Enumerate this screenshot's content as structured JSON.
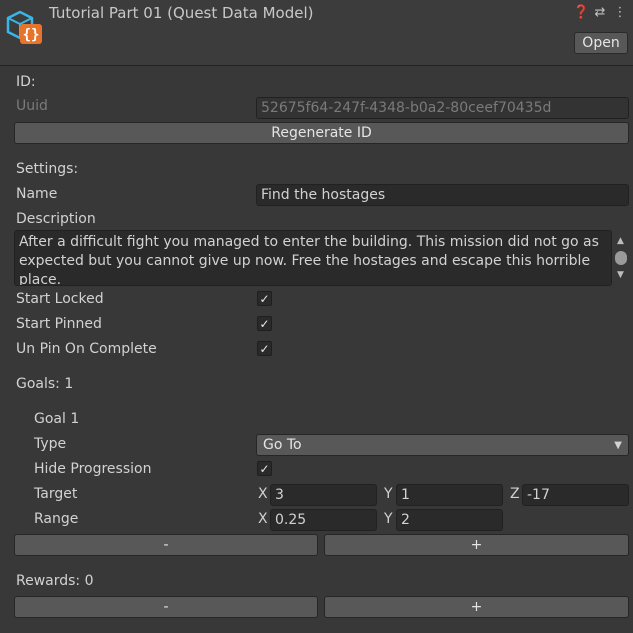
{
  "header": {
    "title": "Tutorial Part 01 (Quest Data Model)",
    "icons": [
      "help-icon",
      "settings-sliders-icon",
      "more-vertical-icon"
    ],
    "open_label": "Open"
  },
  "id_section": {
    "heading": "ID:",
    "uuid_label": "Uuid",
    "uuid_value": "52675f64-247f-4348-b0a2-80ceef70435d",
    "regenerate_label": "Regenerate ID"
  },
  "settings": {
    "heading": "Settings:",
    "name_label": "Name",
    "name_value": "Find the hostages",
    "description_label": "Description",
    "description_value": "After a difficult fight you managed to enter the building. This mission did not go as expected but you cannot give up now. Free the hostages and escape this horrible place.",
    "start_locked_label": "Start Locked",
    "start_locked": true,
    "start_pinned_label": "Start Pinned",
    "start_pinned": true,
    "unpin_label": "Un Pin On Complete",
    "unpin": true
  },
  "goals": {
    "heading": "Goals: 1",
    "goal_title": "Goal 1",
    "type_label": "Type",
    "type_value": "Go To",
    "hide_progression_label": "Hide Progression",
    "hide_progression": true,
    "target_label": "Target",
    "target": {
      "x_label": "X",
      "x": "3",
      "y_label": "Y",
      "y": "1",
      "z_label": "Z",
      "z": "-17"
    },
    "range_label": "Range",
    "range": {
      "x_label": "X",
      "x": "0.25",
      "y_label": "Y",
      "y": "2"
    },
    "remove_label": "-",
    "add_label": "+"
  },
  "rewards": {
    "heading": "Rewards: 0",
    "remove_label": "-",
    "add_label": "+"
  },
  "check_glyph": "✓"
}
